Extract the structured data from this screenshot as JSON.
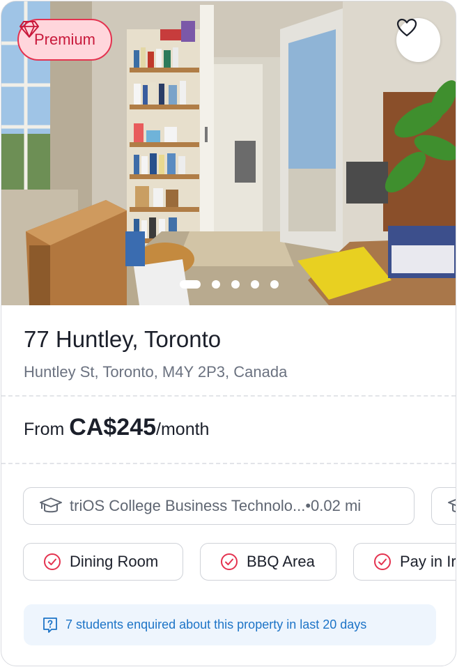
{
  "colors": {
    "accent_red": "#e4324f",
    "badge_bg": "#ffd6dc",
    "notice_blue": "#1d74c7",
    "notice_bg": "#eef5fd"
  },
  "photo": {
    "badge_label": "Premium",
    "badge_icon": "diamond-icon",
    "favorite_icon": "heart-icon",
    "carousel": {
      "total": 5,
      "active_index": 1
    }
  },
  "listing": {
    "title": "77 Huntley, Toronto",
    "address": "Huntley St, Toronto, M4Y 2P3, Canada",
    "price_prefix": "From ",
    "price_amount": "CA$245",
    "price_suffix": "/month"
  },
  "university_chip": {
    "icon": "graduation-cap-icon",
    "name": "triOS College Business Technolo...",
    "separator": " • ",
    "distance": "0.02 mi"
  },
  "amenities": [
    {
      "icon": "check-circle-icon",
      "label": "Dining Room"
    },
    {
      "icon": "check-circle-icon",
      "label": "BBQ Area"
    },
    {
      "icon": "check-circle-icon",
      "label": "Pay in Ir"
    }
  ],
  "notice": {
    "icon": "question-icon",
    "text": "7 students enquired about this property in last 20 days"
  }
}
